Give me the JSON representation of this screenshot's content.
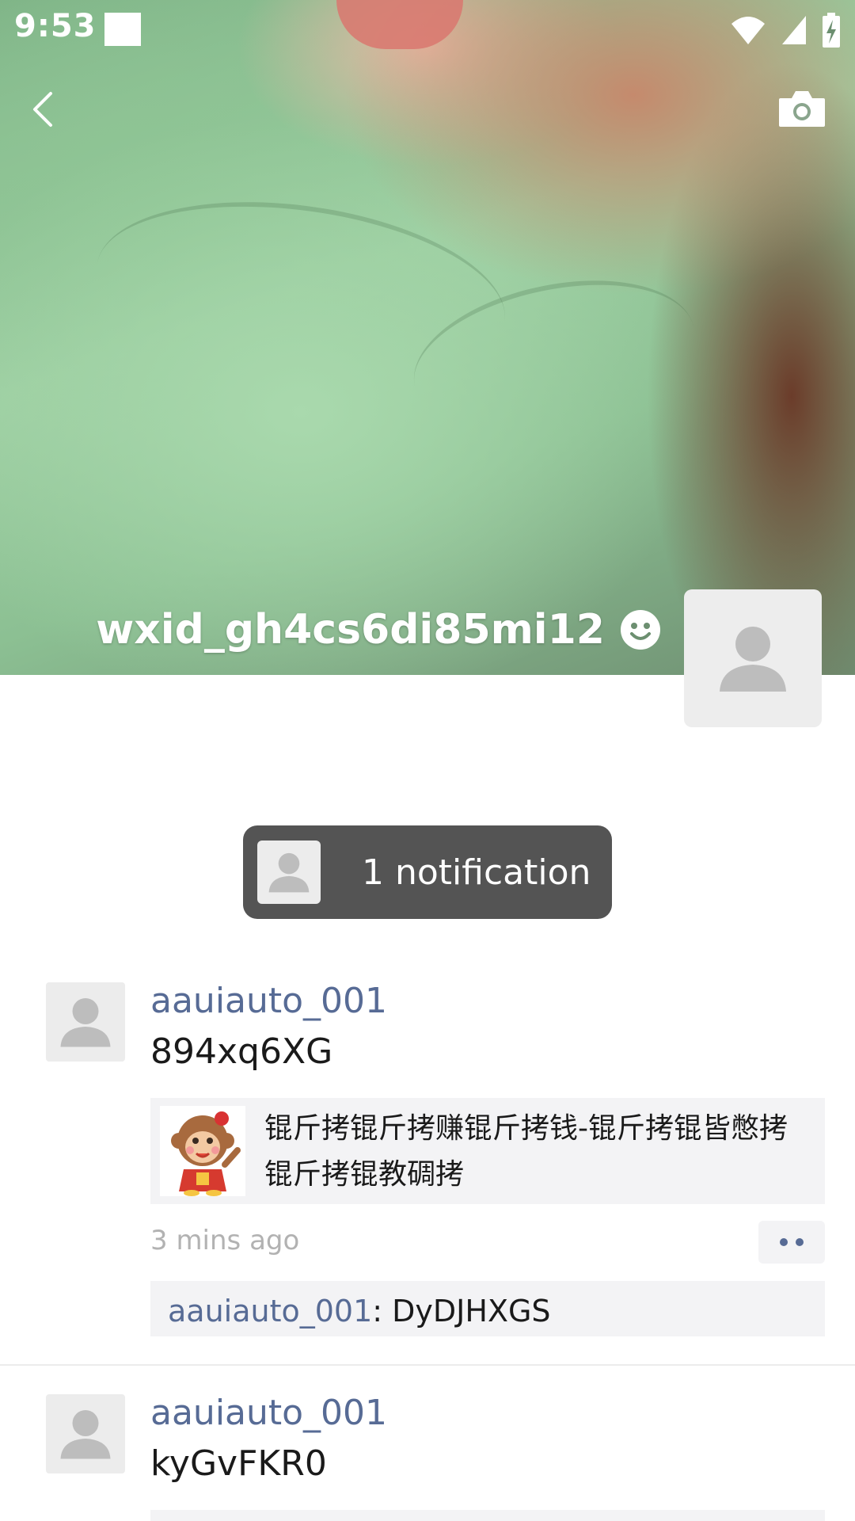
{
  "status_bar": {
    "time": "9:53",
    "icons": [
      "wifi-icon",
      "cell-signal-icon",
      "battery-charging-icon"
    ]
  },
  "nav": {
    "back_icon": "chevron-left-icon",
    "camera_icon": "camera-icon"
  },
  "profile": {
    "name": "wxid_gh4cs6di85mi12",
    "badge_icon": "status-emoji-icon"
  },
  "notification": {
    "label": "1 notification"
  },
  "posts": [
    {
      "user": "aauiauto_001",
      "text": "894xq6XG",
      "link": {
        "title": "锟斤拷锟斤拷赚锟斤拷钱-锟斤拷锟皆憋拷锟斤拷锟教碉拷",
        "thumb_icon": "monkey-sticker-icon"
      },
      "time": "3 mins ago",
      "comment": {
        "author": "aauiauto_001",
        "separator": ": ",
        "text": "DyDJHXGS"
      }
    },
    {
      "user": "aauiauto_001",
      "text": "kyGvFKR0"
    }
  ],
  "colors": {
    "link_blue": "#576b95",
    "pill_bg": "#545454",
    "card_bg": "#f3f3f5",
    "time_gray": "#b2b2b2"
  }
}
